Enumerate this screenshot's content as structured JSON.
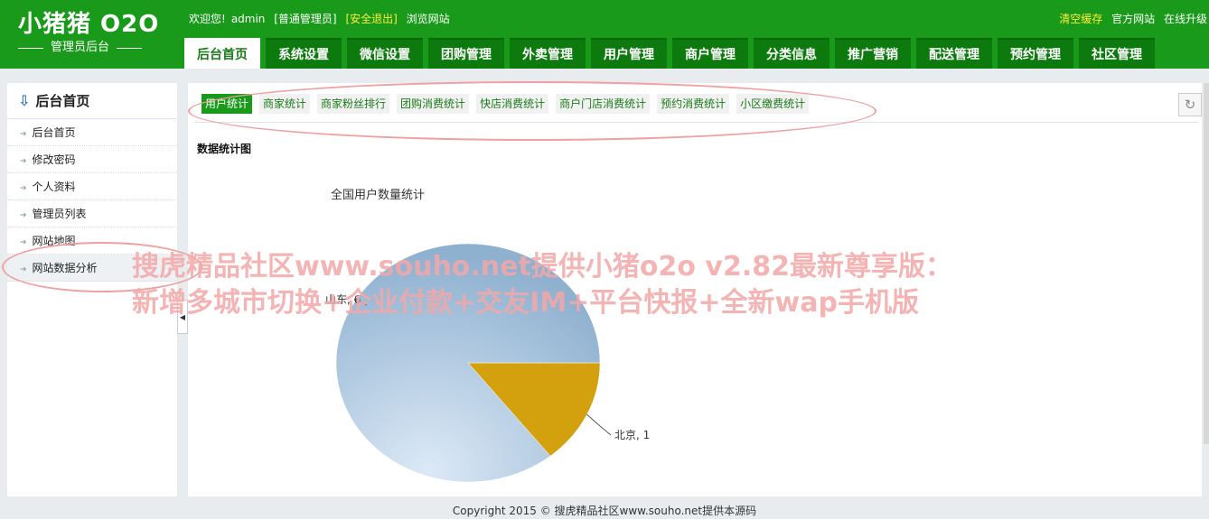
{
  "header": {
    "logo_title": "小猪猪 O2O",
    "logo_subtitle": "管理员后台",
    "welcome_prefix": "欢迎您!",
    "username": "admin",
    "role": "[普通管理员]",
    "logout": "[安全退出]",
    "browse": "浏览网站",
    "clear_cache": "清空缓存",
    "official_site": "官方网站",
    "online_upgrade": "在线升级"
  },
  "nav": {
    "tabs": [
      {
        "label": "后台首页",
        "active": true
      },
      {
        "label": "系统设置"
      },
      {
        "label": "微信设置"
      },
      {
        "label": "团购管理"
      },
      {
        "label": "外卖管理"
      },
      {
        "label": "用户管理"
      },
      {
        "label": "商户管理"
      },
      {
        "label": "分类信息"
      },
      {
        "label": "推广营销"
      },
      {
        "label": "配送管理"
      },
      {
        "label": "预约管理"
      },
      {
        "label": "社区管理"
      }
    ]
  },
  "sidebar": {
    "title": "后台首页",
    "items": [
      {
        "label": "后台首页"
      },
      {
        "label": "修改密码"
      },
      {
        "label": "个人资料"
      },
      {
        "label": "管理员列表"
      },
      {
        "label": "网站地图"
      },
      {
        "label": "网站数据分析",
        "active": true
      }
    ],
    "collapse_glyph": "◀"
  },
  "subtabs": [
    {
      "label": "用户统计",
      "active": true
    },
    {
      "label": "商家统计"
    },
    {
      "label": "商家粉丝排行"
    },
    {
      "label": "团购消费统计"
    },
    {
      "label": "快店消费统计"
    },
    {
      "label": "商户门店消费统计"
    },
    {
      "label": "预约消费统计"
    },
    {
      "label": "小区缴费统计"
    }
  ],
  "refresh_glyph": "↻",
  "section_title": "数据统计图",
  "chart_data": {
    "type": "pie",
    "title": "全国用户数量统计",
    "slices": [
      {
        "name": "山东",
        "value": 6,
        "label": "山东, 6",
        "color": "#97b8d6"
      },
      {
        "name": "北京",
        "value": 1,
        "label": "北京, 1",
        "color": "#d3a00e"
      }
    ]
  },
  "watermark": {
    "line1": "搜虎精品社区www.souho.net提供小猪o2o v2.82最新尊享版：",
    "line2": "新增多城市切换+企业付款+交友IM+平台快报+全新wap手机版"
  },
  "footer": "Copyright 2015 © 搜虎精品社区www.souho.net提供本源码",
  "colors": {
    "brand_green": "#1a9a1a",
    "annotation": "#f0a0a0"
  }
}
